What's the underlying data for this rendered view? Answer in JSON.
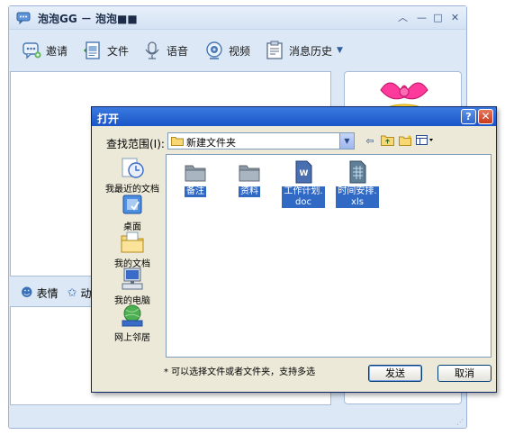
{
  "chat_window": {
    "title": "泡泡GG － 泡泡■■",
    "toolbar": [
      {
        "label": "邀请",
        "icon": "invite-icon"
      },
      {
        "label": "文件",
        "icon": "file-transfer-icon"
      },
      {
        "label": "语音",
        "icon": "voice-icon"
      },
      {
        "label": "视频",
        "icon": "video-icon"
      },
      {
        "label": "消息历史",
        "icon": "message-history-icon"
      }
    ],
    "emote_bar": [
      {
        "label": "表情",
        "icon": "smiley-icon"
      },
      {
        "label": "动",
        "icon": "star-icon"
      }
    ]
  },
  "open_dialog": {
    "title": "打开",
    "help_glyph": "?",
    "close_glyph": "✕",
    "look_in_label": "查找范围(I):",
    "look_in_value": "新建文件夹",
    "places": [
      {
        "label": "我最近的文档",
        "icon": "recent-documents-icon"
      },
      {
        "label": "桌面",
        "icon": "desktop-icon"
      },
      {
        "label": "我的文档",
        "icon": "my-documents-icon"
      },
      {
        "label": "我的电脑",
        "icon": "my-computer-icon"
      },
      {
        "label": "网上邻居",
        "icon": "network-places-icon"
      }
    ],
    "files": [
      {
        "name": "备注",
        "type": "folder"
      },
      {
        "name": "资料",
        "type": "folder"
      },
      {
        "name": "工作计划.doc",
        "line1": "工作计划.",
        "line2": "doc",
        "type": "word"
      },
      {
        "name": "时间安排.xls",
        "line1": "时间安排.",
        "line2": "xls",
        "type": "excel"
      }
    ],
    "hint": "* 可以选择文件或者文件夹，支持多选",
    "send_button": "发送",
    "cancel_button": "取消"
  },
  "colors": {
    "window_bg": "#dce8f6",
    "dialog_bg": "#ece9d8",
    "selection": "#316ac5",
    "title_blue": "#1a55c8"
  }
}
